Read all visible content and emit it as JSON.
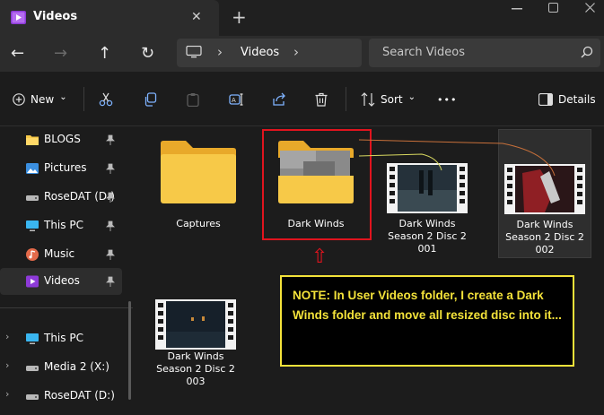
{
  "window": {
    "tab_title": "Videos",
    "close_tab": "✕",
    "new_tab": "+"
  },
  "nav": {
    "back": "←",
    "forward": "→",
    "up": "↑",
    "refresh": "↻",
    "breadcrumb": [
      "Videos"
    ],
    "search_placeholder": "Search Videos"
  },
  "toolbar": {
    "new_label": "New",
    "new_chevron": "⌄",
    "sort_label": "Sort",
    "sort_chevron": "⌄",
    "more_label": "•••",
    "details_label": "Details"
  },
  "sidebar": {
    "pinned": [
      {
        "label": "BLOGS",
        "icon": "folder-icon"
      },
      {
        "label": "Pictures",
        "icon": "pictures-icon"
      },
      {
        "label": "RoseDAT (D:)",
        "icon": "drive-icon"
      },
      {
        "label": "This PC",
        "icon": "computer-icon"
      },
      {
        "label": "Music",
        "icon": "music-icon"
      },
      {
        "label": "Videos",
        "icon": "videos-icon"
      }
    ],
    "tree": [
      {
        "label": "This PC",
        "icon": "computer-icon"
      },
      {
        "label": "Media 2 (X:)",
        "icon": "drive-icon"
      },
      {
        "label": "RoseDAT (D:)",
        "icon": "drive-icon"
      }
    ]
  },
  "content": {
    "items": [
      {
        "label": "Captures",
        "type": "folder"
      },
      {
        "label": "Dark Winds",
        "type": "folder"
      },
      {
        "label": "Dark Winds Season 2 Disc 2 001",
        "type": "video"
      },
      {
        "label": "Dark Winds Season 2 Disc 2 002",
        "type": "video"
      },
      {
        "label": "Dark Winds Season 2 Disc 2 003",
        "type": "video"
      }
    ]
  },
  "annotation": {
    "arrow": "⇧",
    "note": "NOTE: In User Videos folder, I create a Dark Winds folder and move all resized disc into it..."
  },
  "colors": {
    "accent_red": "#e0141e",
    "note_yellow": "#f3e23a",
    "folder_yellow": "#f7c948"
  }
}
